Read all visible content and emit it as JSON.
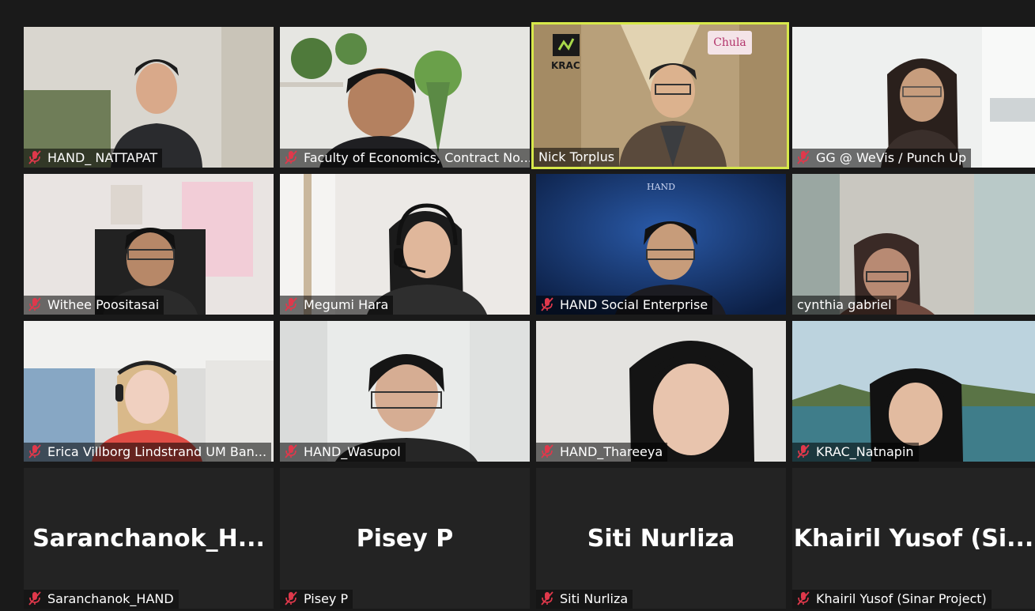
{
  "meeting": {
    "participants": [
      {
        "name": "HAND_ NATTAPAT",
        "muted": true
      },
      {
        "name": "Faculty of Economics, Contract No...",
        "muted": true
      },
      {
        "name": "Nick Torplus",
        "muted": false,
        "active_speaker": true
      },
      {
        "name": "GG @ WeVis / Punch Up",
        "muted": true
      },
      {
        "name": "Withee Poositasai",
        "muted": true
      },
      {
        "name": "Megumi Hara",
        "muted": true
      },
      {
        "name": "HAND Social Enterprise",
        "muted": true
      },
      {
        "name": "cynthia gabriel",
        "muted": false
      },
      {
        "name": "Erica Villborg Lindstrand UM Ban...",
        "muted": true
      },
      {
        "name": "HAND_Wasupol",
        "muted": true
      },
      {
        "name": "HAND_Thareeya",
        "muted": true
      },
      {
        "name": "KRAC_Natnapin",
        "muted": true
      },
      {
        "name": "Saranchanok_HAND",
        "display": "Saranchanok_H...",
        "muted": true
      },
      {
        "name": "Pisey P",
        "display": "Pisey P",
        "muted": true
      },
      {
        "name": "Siti Nurliza",
        "display": "Siti Nurliza",
        "muted": true
      },
      {
        "name": "Khairil Yusof (Sinar Project)",
        "display": "Khairil Yusof (Si...",
        "muted": true
      }
    ],
    "logos": {
      "krac": "KRAC",
      "chula": "Chula",
      "hand": "HAND"
    },
    "colors": {
      "active_speaker_border": "#d7e84a",
      "background": "#1a1a1a",
      "muted_icon": "#e0384b"
    }
  }
}
